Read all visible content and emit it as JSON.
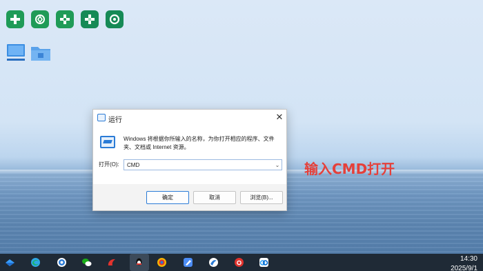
{
  "desktop": {
    "icons": [
      {
        "name": "green-plus-app-1",
        "color": "#1f9b57"
      },
      {
        "name": "green-link-app",
        "color": "#1f9b57"
      },
      {
        "name": "green-plus-app-2",
        "color": "#1f9b57"
      },
      {
        "name": "green-plus-app-3",
        "color": "#168a56"
      },
      {
        "name": "green-recycle-app",
        "color": "#168a56"
      },
      {
        "name": "this-pc",
        "color": "#3b8ee2"
      },
      {
        "name": "folder",
        "color": "#5aa2ea"
      }
    ]
  },
  "run_dialog": {
    "title": "运行",
    "description": "Windows 将根据你所输入的名称，为你打开相应的程序、文件夹、文档或 Internet 资源。",
    "open_label": "打开(O):",
    "input_value": "CMD",
    "ok_label": "确定",
    "cancel_label": "取消",
    "browse_label": "浏览(B)...",
    "close_symbol": "✕"
  },
  "annotation": {
    "text": "输入CMD打开",
    "color": "#e5403a"
  },
  "taskbar": {
    "apps": [
      "widgets",
      "edge",
      "browser",
      "wechat",
      "app-red",
      "qq",
      "photos",
      "notes",
      "browser-blue",
      "netease-music",
      "baidu-netdisk"
    ],
    "time": "14:30",
    "date": "2025/9/1"
  }
}
